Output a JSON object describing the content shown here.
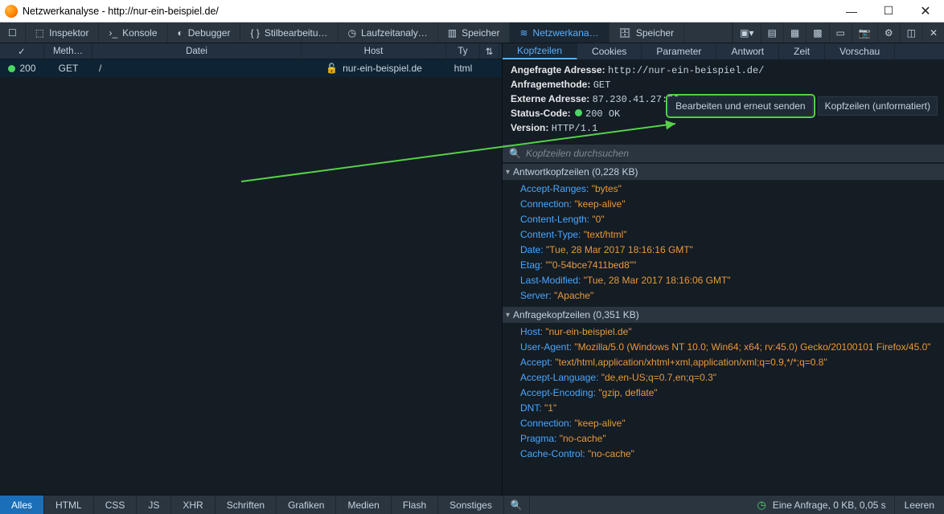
{
  "window": {
    "title": "Netzwerkanalyse - http://nur-ein-beispiel.de/"
  },
  "toolbar": {
    "inspektor": "Inspektor",
    "konsole": "Konsole",
    "debugger": "Debugger",
    "stilbearbeitung": "Stilbearbeitu…",
    "laufzeitanalyse": "Laufzeitanaly…",
    "speicher1": "Speicher",
    "netzwerk": "Netzwerkana…",
    "speicher2": "Speicher"
  },
  "network_table": {
    "headers": {
      "status": "",
      "method": "Meth…",
      "file": "Datei",
      "host": "Host",
      "type": "Ty"
    },
    "rows": [
      {
        "status": "200",
        "method": "GET",
        "file": "/",
        "host": "nur-ein-beispiel.de",
        "type": "html"
      }
    ]
  },
  "detail_tabs": {
    "kopfzeilen": "Kopfzeilen",
    "cookies": "Cookies",
    "parameter": "Parameter",
    "antwort": "Antwort",
    "zeit": "Zeit",
    "vorschau": "Vorschau"
  },
  "summary": {
    "requested_url_label": "Angefragte Adresse:",
    "requested_url": "http://nur-ein-beispiel.de/",
    "method_label": "Anfragemethode:",
    "method": "GET",
    "remote_label": "Externe Adresse:",
    "remote": "87.230.41.27:80",
    "status_label": "Status-Code:",
    "status": "200 OK",
    "version_label": "Version:",
    "version": "HTTP/1.1"
  },
  "buttons": {
    "edit_resend": "Bearbeiten und erneut senden",
    "raw_headers": "Kopfzeilen (unformatiert)"
  },
  "filter": {
    "placeholder": "Kopfzeilen durchsuchen"
  },
  "response_headers": {
    "title": "Antwortkopfzeilen (0,228 KB)",
    "items": [
      {
        "name": "Accept-Ranges",
        "value": "\"bytes\""
      },
      {
        "name": "Connection",
        "value": "\"keep-alive\""
      },
      {
        "name": "Content-Length",
        "value": "\"0\""
      },
      {
        "name": "Content-Type",
        "value": "\"text/html\""
      },
      {
        "name": "Date",
        "value": "\"Tue, 28 Mar 2017 18:16:16 GMT\""
      },
      {
        "name": "Etag",
        "value": "\"\"0-54bce7411bed8\"\""
      },
      {
        "name": "Last-Modified",
        "value": "\"Tue, 28 Mar 2017 18:16:06 GMT\""
      },
      {
        "name": "Server",
        "value": "\"Apache\""
      }
    ]
  },
  "request_headers": {
    "title": "Anfragekopfzeilen (0,351 KB)",
    "items": [
      {
        "name": "Host",
        "value": "\"nur-ein-beispiel.de\""
      },
      {
        "name": "User-Agent",
        "value": "\"Mozilla/5.0 (Windows NT 10.0; Win64; x64; rv:45.0) Gecko/20100101 Firefox/45.0\""
      },
      {
        "name": "Accept",
        "value": "\"text/html,application/xhtml+xml,application/xml;q=0.9,*/*;q=0.8\""
      },
      {
        "name": "Accept-Language",
        "value": "\"de,en-US;q=0.7,en;q=0.3\""
      },
      {
        "name": "Accept-Encoding",
        "value": "\"gzip, deflate\""
      },
      {
        "name": "DNT",
        "value": "\"1\""
      },
      {
        "name": "Connection",
        "value": "\"keep-alive\""
      },
      {
        "name": "Pragma",
        "value": "\"no-cache\""
      },
      {
        "name": "Cache-Control",
        "value": "\"no-cache\""
      }
    ]
  },
  "filters": {
    "alles": "Alles",
    "html": "HTML",
    "css": "CSS",
    "js": "JS",
    "xhr": "XHR",
    "schriften": "Schriften",
    "grafiken": "Grafiken",
    "medien": "Medien",
    "flash": "Flash",
    "sonstiges": "Sonstiges"
  },
  "footer": {
    "summary": "Eine Anfrage, 0 KB, 0,05 s",
    "leeren": "Leeren"
  }
}
